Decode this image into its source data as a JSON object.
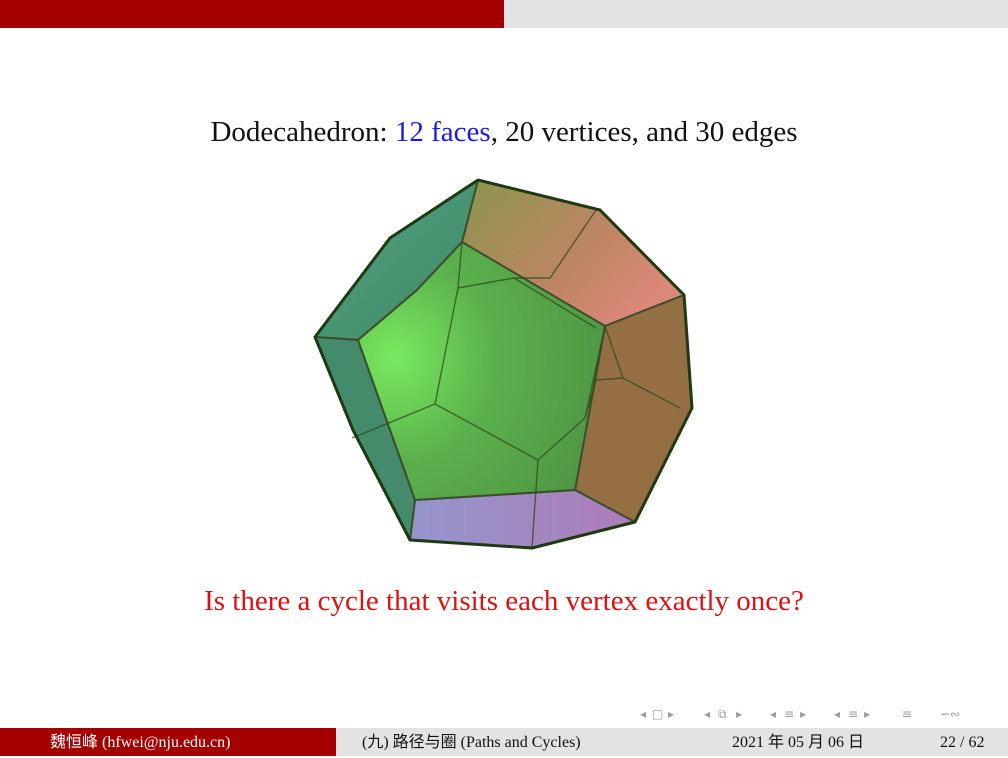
{
  "slide": {
    "progress_fraction": 0.5,
    "title_prefix": "Dodecahedron: ",
    "title_faces": "12 faces",
    "title_suffix": ", 20 vertices, and 30 edges",
    "question": "Is there a cycle that visits each vertex exactly once?"
  },
  "colors": {
    "accent": "#a40000",
    "bar_gray": "#e3e3e3",
    "highlight_blue": "#1a1ae6",
    "question_red": "#e01010"
  },
  "figure": {
    "description_icon": "dodecahedron-icon"
  },
  "nav": {
    "frame_prev": "◂",
    "frame_icon": "□",
    "frame_next": "▸",
    "sub_prev": "◂",
    "sub_icon": "⧉",
    "sub_next": "▸",
    "sec_prev": "◂",
    "sec_icon": "≡",
    "sec_next": "▸",
    "subsec_prev": "◂",
    "subsec_icon": "≡",
    "subsec_next": "▸",
    "align_icon": "≡",
    "search_icon": "∽∾"
  },
  "footer": {
    "author": "魏恒峰  (hfwei@nju.edu.cn)",
    "talk_title": "(九) 路径与圈 (Paths and Cycles)",
    "date": "2021 年 05 月 06 日",
    "page": "22 / 62"
  }
}
